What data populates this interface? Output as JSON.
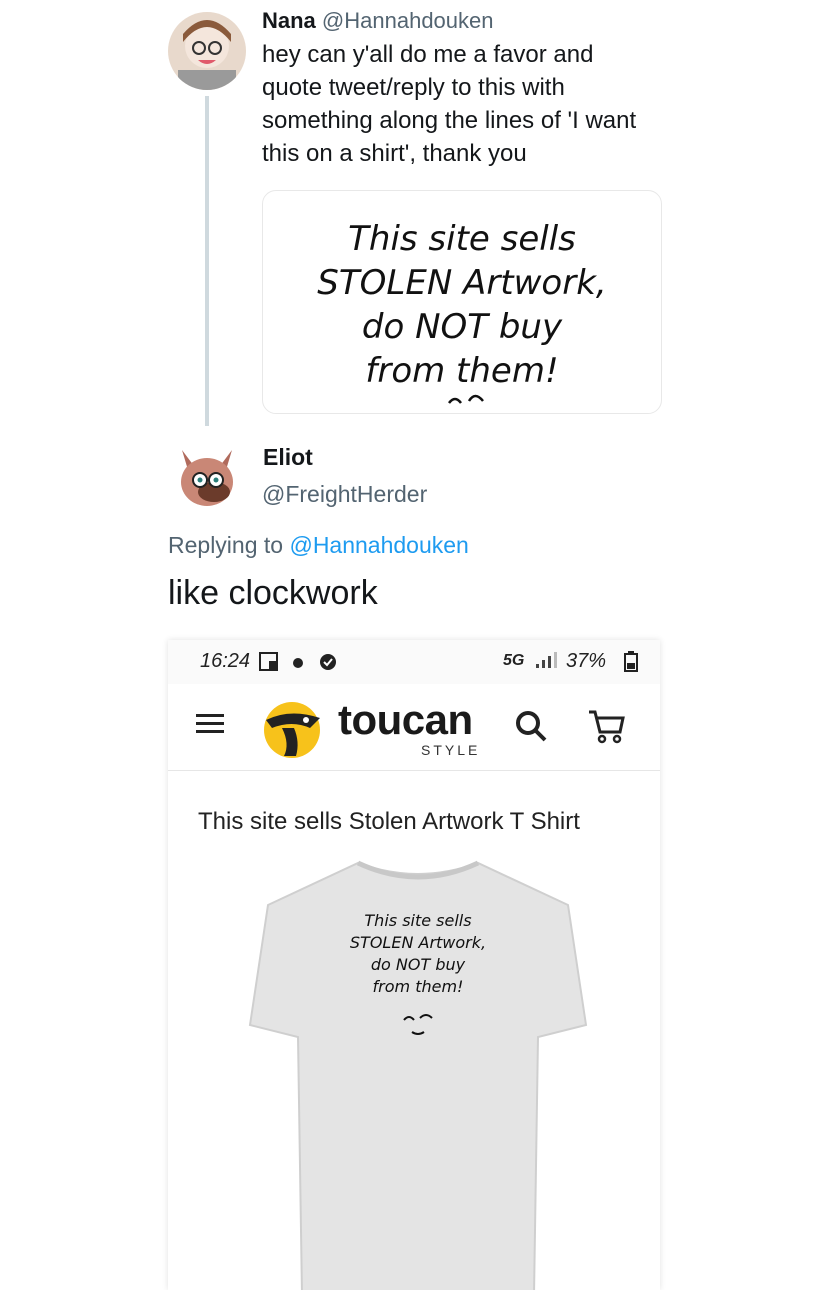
{
  "tweet1": {
    "display_name": "Nana",
    "handle": "@Hannahdouken",
    "text_lines": [
      "hey can y'all do me a favor and",
      "quote tweet/reply to this with",
      "something along the lines of 'I want",
      "this on a shirt', thank you"
    ],
    "image_text": [
      "This site sells",
      "STOLEN Artwork,",
      "do NOT buy",
      "from them!"
    ]
  },
  "tweet2": {
    "display_name": "Eliot",
    "handle": "@FreightHerder",
    "replying_prefix": "Replying to",
    "replying_handle": "@Hannahdouken",
    "text": "like clockwork"
  },
  "phone": {
    "status_time": "16:24",
    "status_right": "5G",
    "battery": "37%",
    "site_name": "toucan",
    "site_sub": "STYLE",
    "product_title": "This site sells Stolen Artwork T Shirt",
    "shirt_text": [
      "This site sells",
      "STOLEN Artwork,",
      "do NOT buy",
      "from them!"
    ]
  },
  "colors": {
    "link": "#1d9bf0",
    "handle": "#536471",
    "logo_yellow": "#f7c21b"
  }
}
